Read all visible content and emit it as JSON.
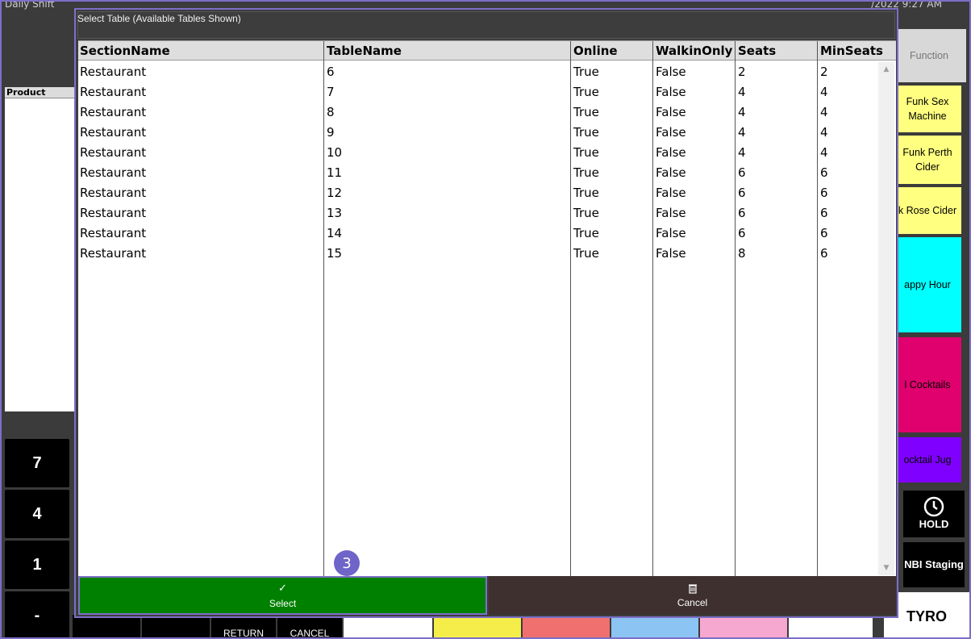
{
  "background": {
    "window_title": "Daily Shift",
    "datetime": "/2022 9:27 AM",
    "product_header": "Product",
    "numpad": [
      "7",
      "4",
      "1",
      "-"
    ],
    "function_header": "Function",
    "function_buttons": [
      {
        "label": "Funk Sex Machine",
        "color": "#ffff80"
      },
      {
        "label": "Funk Perth Cider",
        "color": "#ffff80"
      },
      {
        "label": "k Rose Cider",
        "color": "#ffff80"
      },
      {
        "label": "appy Hour",
        "color": "#00ffff"
      },
      {
        "label": "l Cocktails",
        "color": "#e0006e"
      },
      {
        "label": "ocktail Jug",
        "color": "#8000ff"
      }
    ],
    "hold_label": "HOLD",
    "nbi_label": "NBI Staging",
    "tyro_label": "TYRO",
    "bottom_buttons": [
      {
        "label": "RETURN"
      },
      {
        "label": "CANCEL"
      }
    ]
  },
  "dialog": {
    "title": "Select Table  (Available Tables Shown)",
    "columns": [
      "SectionName",
      "TableName",
      "Online",
      "WalkinOnly",
      "Seats",
      "MinSeats"
    ],
    "rows": [
      [
        "Restaurant",
        "6",
        "True",
        "False",
        "2",
        "2"
      ],
      [
        "Restaurant",
        "7",
        "True",
        "False",
        "4",
        "4"
      ],
      [
        "Restaurant",
        "8",
        "True",
        "False",
        "4",
        "4"
      ],
      [
        "Restaurant",
        "9",
        "True",
        "False",
        "4",
        "4"
      ],
      [
        "Restaurant",
        "10",
        "True",
        "False",
        "4",
        "4"
      ],
      [
        "Restaurant",
        "11",
        "True",
        "False",
        "6",
        "6"
      ],
      [
        "Restaurant",
        "12",
        "True",
        "False",
        "6",
        "6"
      ],
      [
        "Restaurant",
        "13",
        "True",
        "False",
        "6",
        "6"
      ],
      [
        "Restaurant",
        "14",
        "True",
        "False",
        "6",
        "6"
      ],
      [
        "Restaurant",
        "15",
        "True",
        "False",
        "8",
        "6"
      ]
    ],
    "select_icon": "checkmark-icon",
    "select_label": "Select",
    "cancel_icon": "trash-icon",
    "cancel_label": "Cancel",
    "step_badge": "3"
  },
  "colors": {
    "select_bg": "#008000",
    "cancel_bg": "#3f3030",
    "accent": "#7c6fc8"
  }
}
